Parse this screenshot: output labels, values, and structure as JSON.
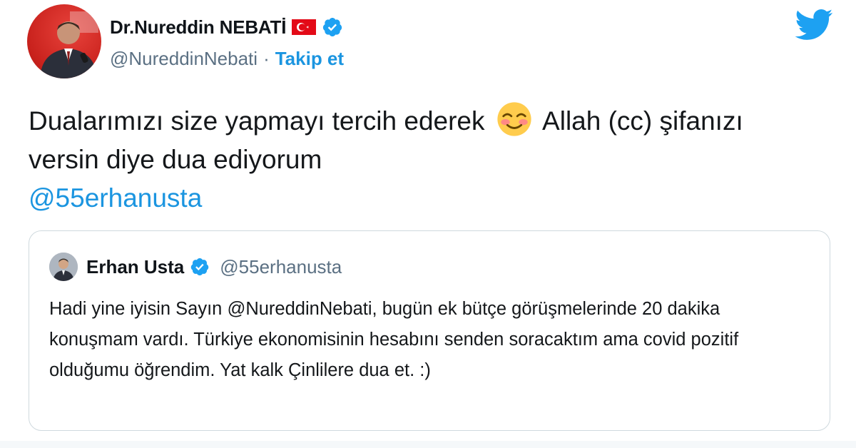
{
  "author": {
    "display_name": "Dr.Nureddin NEBATİ",
    "handle": "@NureddinNebati",
    "separator": "·",
    "follow_label": "Takip et",
    "flag_icon": "turkey-flag-icon",
    "verified_icon": "verified-badge-icon"
  },
  "brand": {
    "logo_icon": "twitter-bird-icon",
    "accent_color": "#1b95e0"
  },
  "tweet": {
    "text_part1": "Dualarımızı size yapmayı tercih ederek",
    "emoji": "smiling-face-with-blush-emoji",
    "text_part2": "Allah (cc) şifanızı versin diye dua ediyorum",
    "mention": "@55erhanusta"
  },
  "quoted_tweet": {
    "display_name": "Erhan Usta",
    "handle": "@55erhanusta",
    "verified_icon": "verified-badge-icon",
    "text": "Hadi yine iyisin Sayın @NureddinNebati, bugün ek bütçe görüşmelerinde 20 dakika konuşmam vardı. Türkiye ekonomisinin hesabını senden soracaktım ama covid pozitif olduğumu öğrendim. Yat kalk Çinlilere dua et. :)"
  }
}
